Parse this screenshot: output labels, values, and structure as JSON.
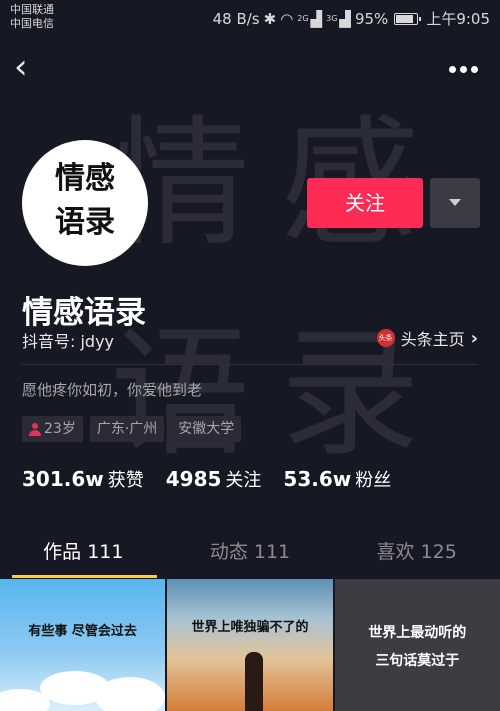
{
  "status_bar": {
    "carrier_1": "中国联通",
    "carrier_2": "中国电信",
    "network_speed": "48 B/s",
    "network_2g": "2G",
    "network_3g": "3G",
    "battery": "95%",
    "time": "上午9:05"
  },
  "background_text": "情感语录",
  "profile": {
    "avatar_line_1": "情感",
    "avatar_line_2": "语录",
    "nickname": "情感语录",
    "douyin_id": "抖音号: jdyy",
    "toutiao_icon_text": "头条",
    "toutiao_link": "头条主页",
    "signature": "愿他疼你如初，你爱他到老",
    "tags": [
      "23岁",
      "广东·广州",
      "安徽大学"
    ]
  },
  "actions": {
    "follow_label": "关注"
  },
  "stats": [
    {
      "value": "301.6w",
      "label": "获赞"
    },
    {
      "value": "4985",
      "label": "关注"
    },
    {
      "value": "53.6w",
      "label": "粉丝"
    }
  ],
  "tabs": [
    {
      "label": "作品 111",
      "active": true
    },
    {
      "label": "动态 111",
      "active": false
    },
    {
      "label": "喜欢 125",
      "active": false
    }
  ],
  "videos": [
    {
      "caption": "有些事 尽管会过去"
    },
    {
      "caption": "世界上唯独骗不了的"
    },
    {
      "caption_line_1": "世界上最动听的",
      "caption_line_2": "三句话莫过于"
    }
  ],
  "colors": {
    "background": "#161823",
    "follow_button": "#fe2c55",
    "tab_indicator": "#f7ce46",
    "muted_text": "#a6a7ad"
  },
  "icons": [
    "back-arrow-icon",
    "more-dots-icon",
    "dropdown-triangle-icon",
    "toutiao-icon",
    "chevron-right-icon",
    "person-icon",
    "wifi-icon",
    "bluetooth-icon",
    "battery-icon"
  ]
}
